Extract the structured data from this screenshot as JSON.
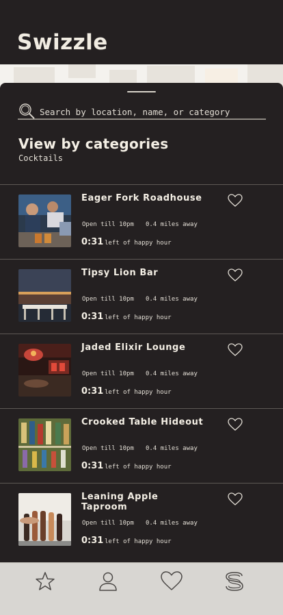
{
  "app": {
    "title": "Swizzle"
  },
  "search": {
    "placeholder": "Search by location, name, or category"
  },
  "section": {
    "title": "View by categories",
    "subtitle": "Cocktails"
  },
  "venues": [
    {
      "name": "Eager Fork Roadhouse",
      "hours": "Open till 10pm",
      "distance": "0.4 miles away",
      "timer": "0:31",
      "timer_note": "left of happy hour"
    },
    {
      "name": "Tipsy Lion Bar",
      "hours": "Open till 10pm",
      "distance": "0.4 miles away",
      "timer": "0:31",
      "timer_note": "left of happy hour"
    },
    {
      "name": "Jaded Elixir Lounge",
      "hours": "Open till 10pm",
      "distance": "0.4 miles away",
      "timer": "0:31",
      "timer_note": "left of happy hour"
    },
    {
      "name": "Crooked Table Hideout",
      "hours": "Open till 10pm",
      "distance": "0.4 miles away",
      "timer": "0:31",
      "timer_note": "left of happy hour"
    },
    {
      "name": "Leaning Apple Taproom",
      "hours": "Open till 10pm",
      "distance": "0.4 miles away",
      "timer": "0:31",
      "timer_note": "left of happy hour"
    }
  ],
  "tabs": [
    {
      "icon": "star-icon"
    },
    {
      "icon": "user-icon"
    },
    {
      "icon": "heart-icon"
    },
    {
      "icon": "swizzle-logo-icon"
    }
  ],
  "colors": {
    "background": "#242021",
    "text": "#f1ece2",
    "tabbar": "#d8d6d2"
  }
}
